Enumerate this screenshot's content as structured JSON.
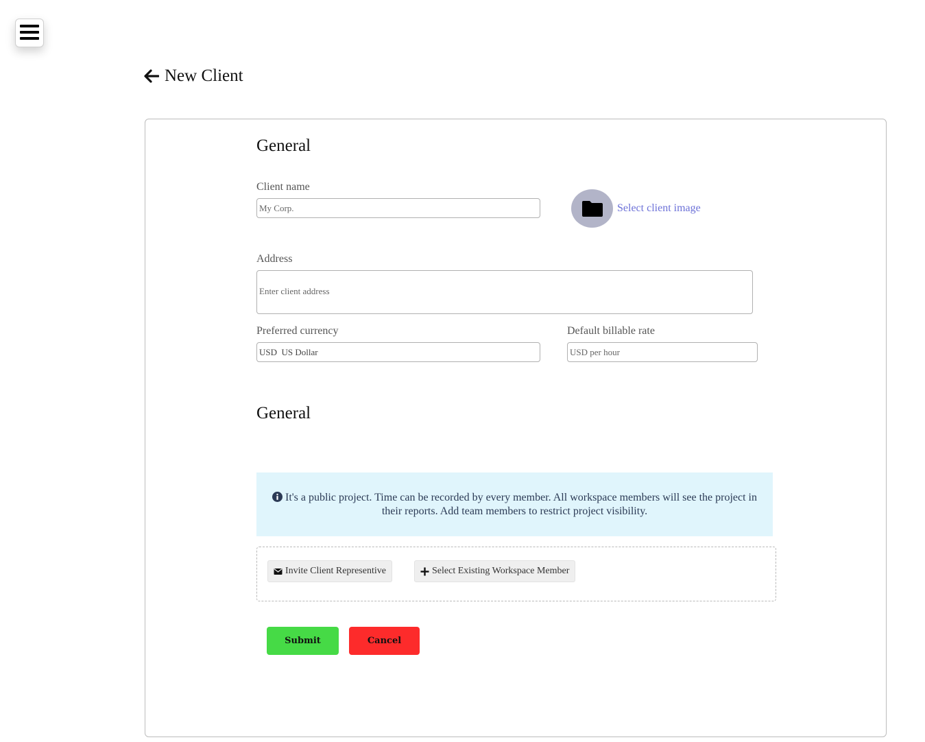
{
  "header": {
    "title": "New Client"
  },
  "general_section": {
    "title": "General",
    "client_name": {
      "label": "Client name",
      "placeholder": "My Corp."
    },
    "client_image": {
      "link_label": "Select client image"
    },
    "address": {
      "label": "Address",
      "placeholder": "Enter client address"
    },
    "currency": {
      "label": "Preferred currency",
      "value": "USD  US Dollar"
    },
    "billable_rate": {
      "label": "Default billable rate",
      "placeholder": "USD per hour"
    }
  },
  "members_section": {
    "title": "General",
    "info_text": "It's a public project. Time can be recorded by every member. All workspace members will see the project in their reports. Add team members to restrict project visibility.",
    "invite_label": "Invite Client Representive",
    "select_member_label": "Select Existing Workspace Member"
  },
  "actions": {
    "submit_label": "Submit",
    "cancel_label": "Cancel"
  },
  "colors": {
    "submit": "#46da46",
    "cancel": "#fd2b2b",
    "link": "#6d72d8",
    "info_bg": "#e0f5fc"
  }
}
